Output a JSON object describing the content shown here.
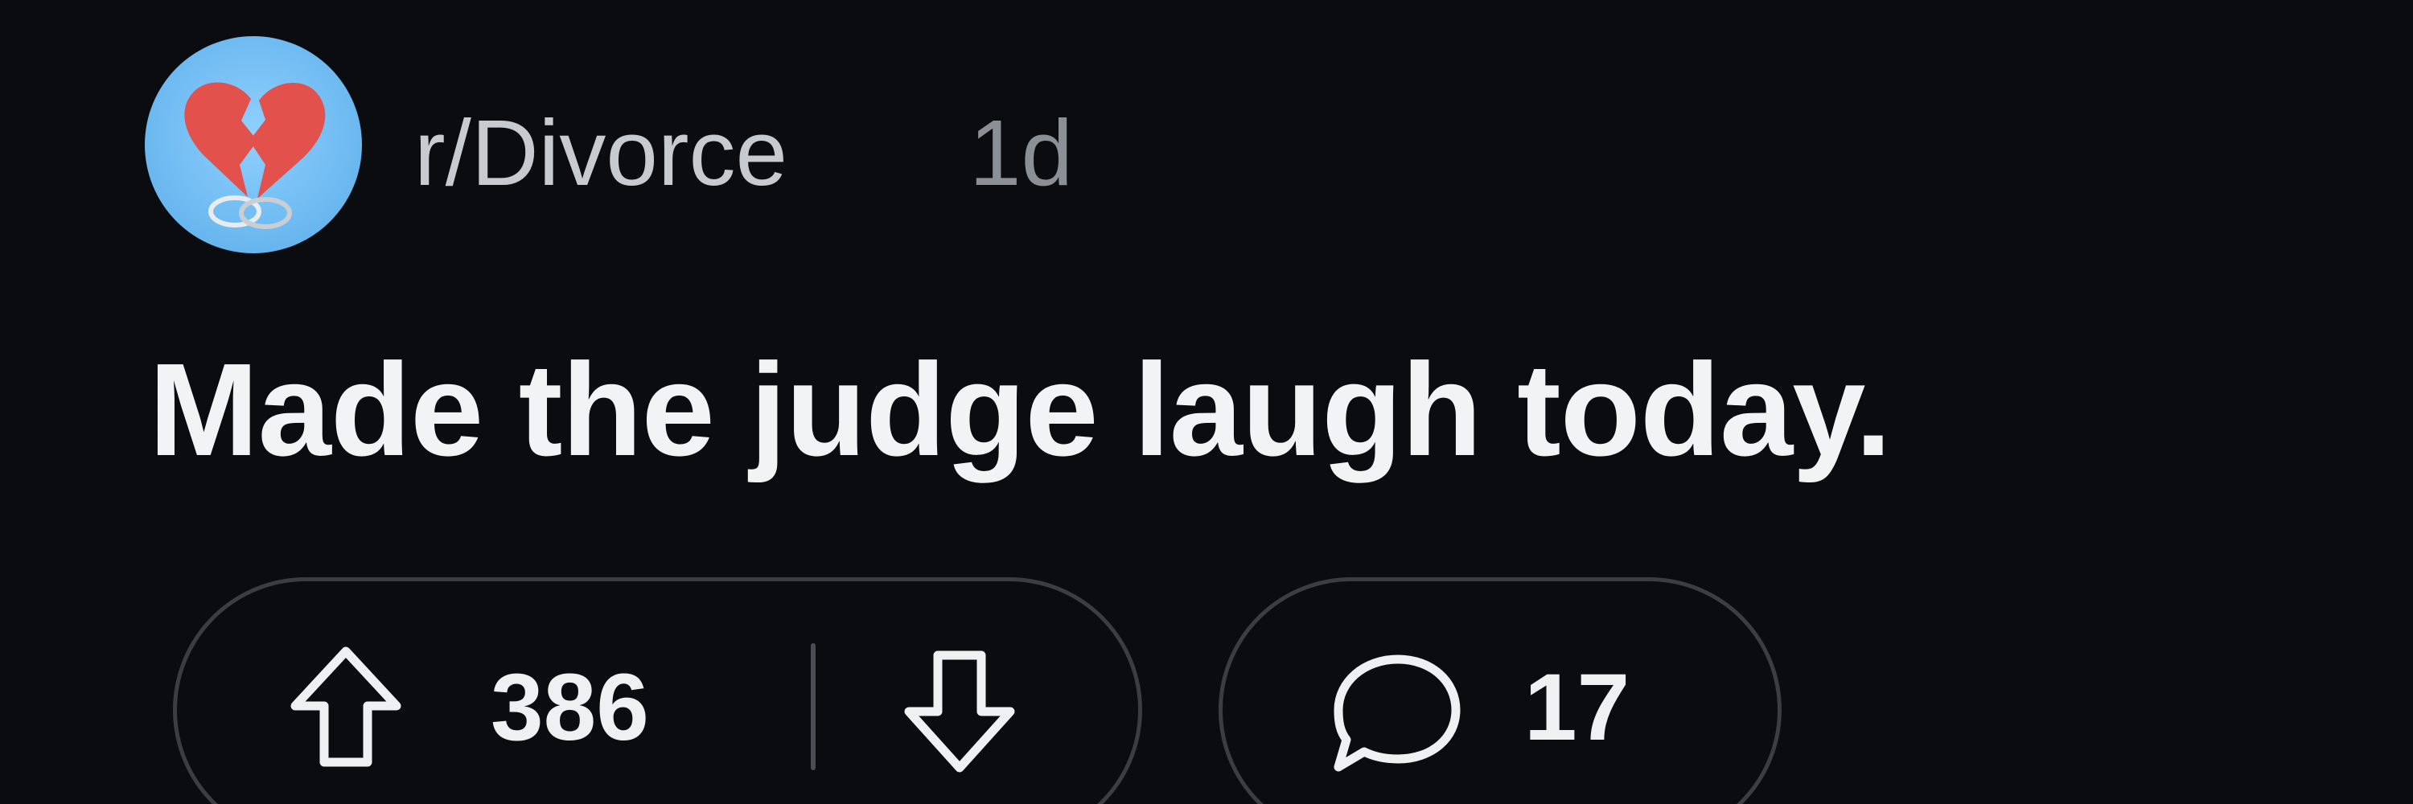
{
  "post": {
    "subreddit": "r/Divorce",
    "age": "1d",
    "title": "Made the judge laugh today.",
    "avatar_icon": "broken-heart-rings-icon",
    "votes": {
      "count": "386",
      "upvote_icon": "arrow-up-icon",
      "downvote_icon": "arrow-down-icon"
    },
    "comments": {
      "count": "17",
      "icon": "comment-bubble-icon"
    }
  },
  "colors": {
    "background": "#0b0c0f",
    "avatar_bg": "#69b7ef",
    "heart": "#e2514b",
    "pill_border": "#3a3d42"
  }
}
